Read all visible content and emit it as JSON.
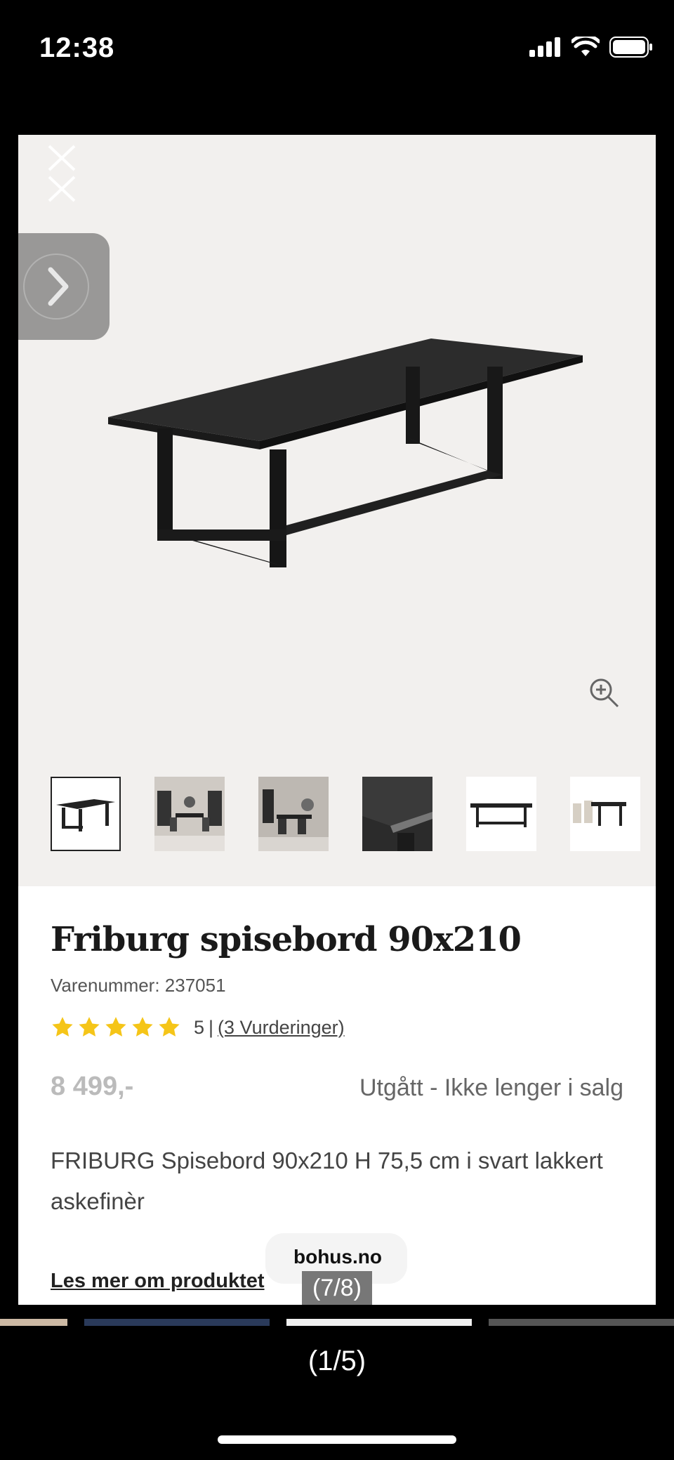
{
  "status_bar": {
    "time": "12:38"
  },
  "gallery": {
    "thumbnails": [
      "table-product",
      "dining-room-1",
      "dining-room-2",
      "wood-detail",
      "table-front",
      "table-with-chairs"
    ],
    "selected_index": 0
  },
  "product": {
    "title": "Friburg spisebord 90x210",
    "sku": "Varenummer: 237051",
    "rating": {
      "stars": 5,
      "score": "5",
      "separator": "|",
      "reviews_link": "(3 Vurderinger)"
    },
    "price": "8 499,-",
    "availability": "Utgått - Ikke lenger i salg",
    "description": "FRIBURG Spisebord 90x210 H 75,5 cm i svart lakkert askefinèr",
    "read_more": "Les mer om produktet"
  },
  "overlay": {
    "domain": "bohus.no",
    "page_counter": "(7/8)"
  },
  "viewer": {
    "counter": "(1/5)"
  },
  "colors": {
    "star": "#f5c518",
    "background": "#000000",
    "gallery_bg": "#f2f0ee"
  }
}
